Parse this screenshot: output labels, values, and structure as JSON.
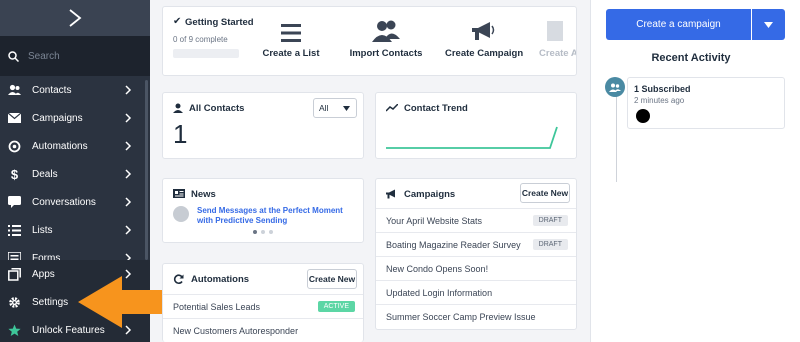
{
  "sidebar": {
    "search_placeholder": "Search",
    "items": [
      {
        "label": "Contacts",
        "icon": "contacts-icon"
      },
      {
        "label": "Campaigns",
        "icon": "envelope-icon"
      },
      {
        "label": "Automations",
        "icon": "automation-icon"
      },
      {
        "label": "Deals",
        "icon": "dollar-icon"
      },
      {
        "label": "Conversations",
        "icon": "chat-icon"
      },
      {
        "label": "Lists",
        "icon": "list-icon"
      },
      {
        "label": "Forms",
        "icon": "form-icon"
      }
    ],
    "bottom_items": [
      {
        "label": "Apps",
        "icon": "apps-icon"
      },
      {
        "label": "Settings",
        "icon": "gear-icon"
      },
      {
        "label": "Unlock Features",
        "icon": "star-icon"
      }
    ]
  },
  "getting_started": {
    "title": "Getting Started",
    "progress_text": "0 of 9 complete",
    "progress": 0,
    "actions": [
      {
        "label": "Create a List",
        "icon": "list-lines-icon"
      },
      {
        "label": "Import Contacts",
        "icon": "people-icon"
      },
      {
        "label": "Create Campaign",
        "icon": "megaphone-icon"
      },
      {
        "label": "Create A",
        "icon": "truncated-action-icon"
      }
    ]
  },
  "all_contacts": {
    "title": "All Contacts",
    "filter_value": "All",
    "count": "1"
  },
  "contact_trend": {
    "title": "Contact Trend"
  },
  "news": {
    "title": "News",
    "headline": "Send Messages at the Perfect Moment with Predictive Sending"
  },
  "campaigns": {
    "title": "Campaigns",
    "button": "Create New",
    "rows": [
      {
        "name": "Your April Website Stats",
        "status": "DRAFT"
      },
      {
        "name": "Boating Magazine Reader Survey",
        "status": "DRAFT"
      },
      {
        "name": "New Condo Opens Soon!",
        "status": ""
      },
      {
        "name": "Updated Login Information",
        "status": ""
      },
      {
        "name": "Summer Soccer Camp Preview Issue",
        "status": ""
      }
    ]
  },
  "automations": {
    "title": "Automations",
    "button": "Create New",
    "rows": [
      {
        "name": "Potential Sales Leads",
        "status": "ACTIVE"
      },
      {
        "name": "New Customers Autoresponder",
        "status": ""
      }
    ]
  },
  "right_panel": {
    "create_button": "Create a campaign",
    "recent_title": "Recent Activity",
    "activity": {
      "title": "1 Subscribed",
      "time": "2 minutes ago"
    }
  },
  "colors": {
    "sidebar": "#2b3340",
    "accent_blue": "#356ae6",
    "trend_green": "#3ec69a",
    "arrow_orange": "#f7941d",
    "active_green": "#5cd6a5"
  }
}
